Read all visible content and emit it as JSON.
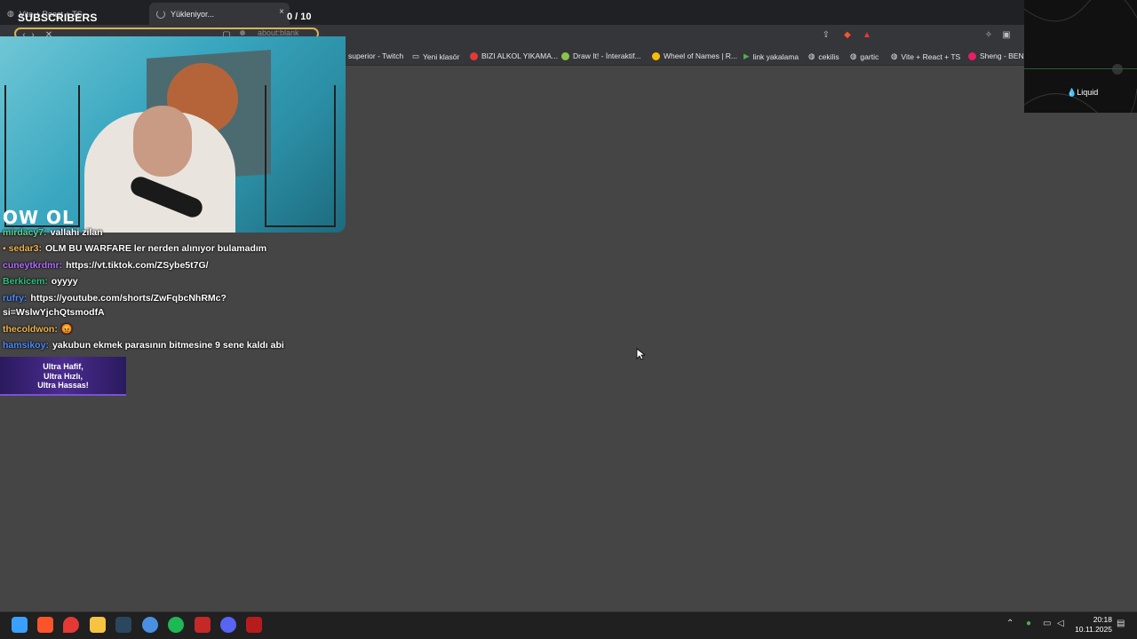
{
  "browser": {
    "tabs": [
      {
        "label": "Vite + React + TS"
      },
      {
        "label": "Yükleniyor...",
        "close": "×"
      }
    ],
    "address": "about:blank",
    "bookmarks": [
      {
        "label": "superior - Twitch",
        "icon_color": "#9146ff"
      },
      {
        "label": "Yeni klasör",
        "icon_color": "#cccccc"
      },
      {
        "label": "BIZI ALKOL YIKAMA...",
        "icon_color": "#e53935"
      },
      {
        "label": "Draw It! - İnteraktif...",
        "icon_color": "#8bc34a"
      },
      {
        "label": "Wheel of Names | R...",
        "icon_color": "#fbbc05"
      },
      {
        "label": "link yakalama",
        "icon_color": "#4caf50"
      },
      {
        "label": "cekilis",
        "icon_color": "#cccccc"
      },
      {
        "label": "gartic",
        "icon_color": "#cccccc"
      },
      {
        "label": "Vite + React + TS",
        "icon_color": "#cccccc"
      },
      {
        "label": "Sheng - BENZ",
        "icon_color": "#e91e63"
      }
    ]
  },
  "overlay": {
    "subs_label": "SUBSCRIBERS",
    "subs_count": "0 / 10",
    "webcam_logo": "OW OL",
    "chat": [
      {
        "user": "mirdacy7:",
        "color": "#5fd38d",
        "msg": "vallahi zilan"
      },
      {
        "user": "sedar3:",
        "color": "#f0b44a",
        "msg": "OLM BU WARFARE ler nerden alınıyor bulamadım"
      },
      {
        "user": "cuneytkrdmr:",
        "color": "#b26bff",
        "msg": "https://vt.tiktok.com/ZSybe5t7G/"
      },
      {
        "user": "Berkicem:",
        "color": "#2ec27e",
        "msg": "oyyyy"
      },
      {
        "user": "rufry:",
        "color": "#4a8cff",
        "msg": "https://youtube.com/shorts/ZwFqbcNhRMc?"
      },
      {
        "user": "",
        "color": "#ffffff",
        "msg": "si=WslwYjchQtsmodfA"
      },
      {
        "user": "thecoldwon:",
        "color": "#f0b44a",
        "msg": "😡"
      },
      {
        "user": "hamsikoy:",
        "color": "#4a8cff",
        "msg": "yakubun ekmek parasının bitmesine 9 sene kaldı abi"
      }
    ],
    "ad_lines": [
      "Ultra Hafif,",
      "Ultra Hızlı,",
      "Ultra Hassas!"
    ]
  },
  "panel": {
    "label": "💧Liquid"
  },
  "taskbar": {
    "time": "20:18",
    "date": "10.11.2025",
    "apps": [
      {
        "name": "start",
        "color": "#3aa0ff"
      },
      {
        "name": "brave",
        "color": "#fb542b"
      },
      {
        "name": "maps",
        "color": "#e53935"
      },
      {
        "name": "files",
        "color": "#f6c343"
      },
      {
        "name": "steam",
        "color": "#2a475e"
      },
      {
        "name": "app",
        "color": "#4a90e2"
      },
      {
        "name": "spotify",
        "color": "#1db954"
      },
      {
        "name": "app-red",
        "color": "#c62828"
      },
      {
        "name": "discord",
        "color": "#5865f2"
      },
      {
        "name": "app-last",
        "color": "#b71c1c"
      }
    ]
  }
}
